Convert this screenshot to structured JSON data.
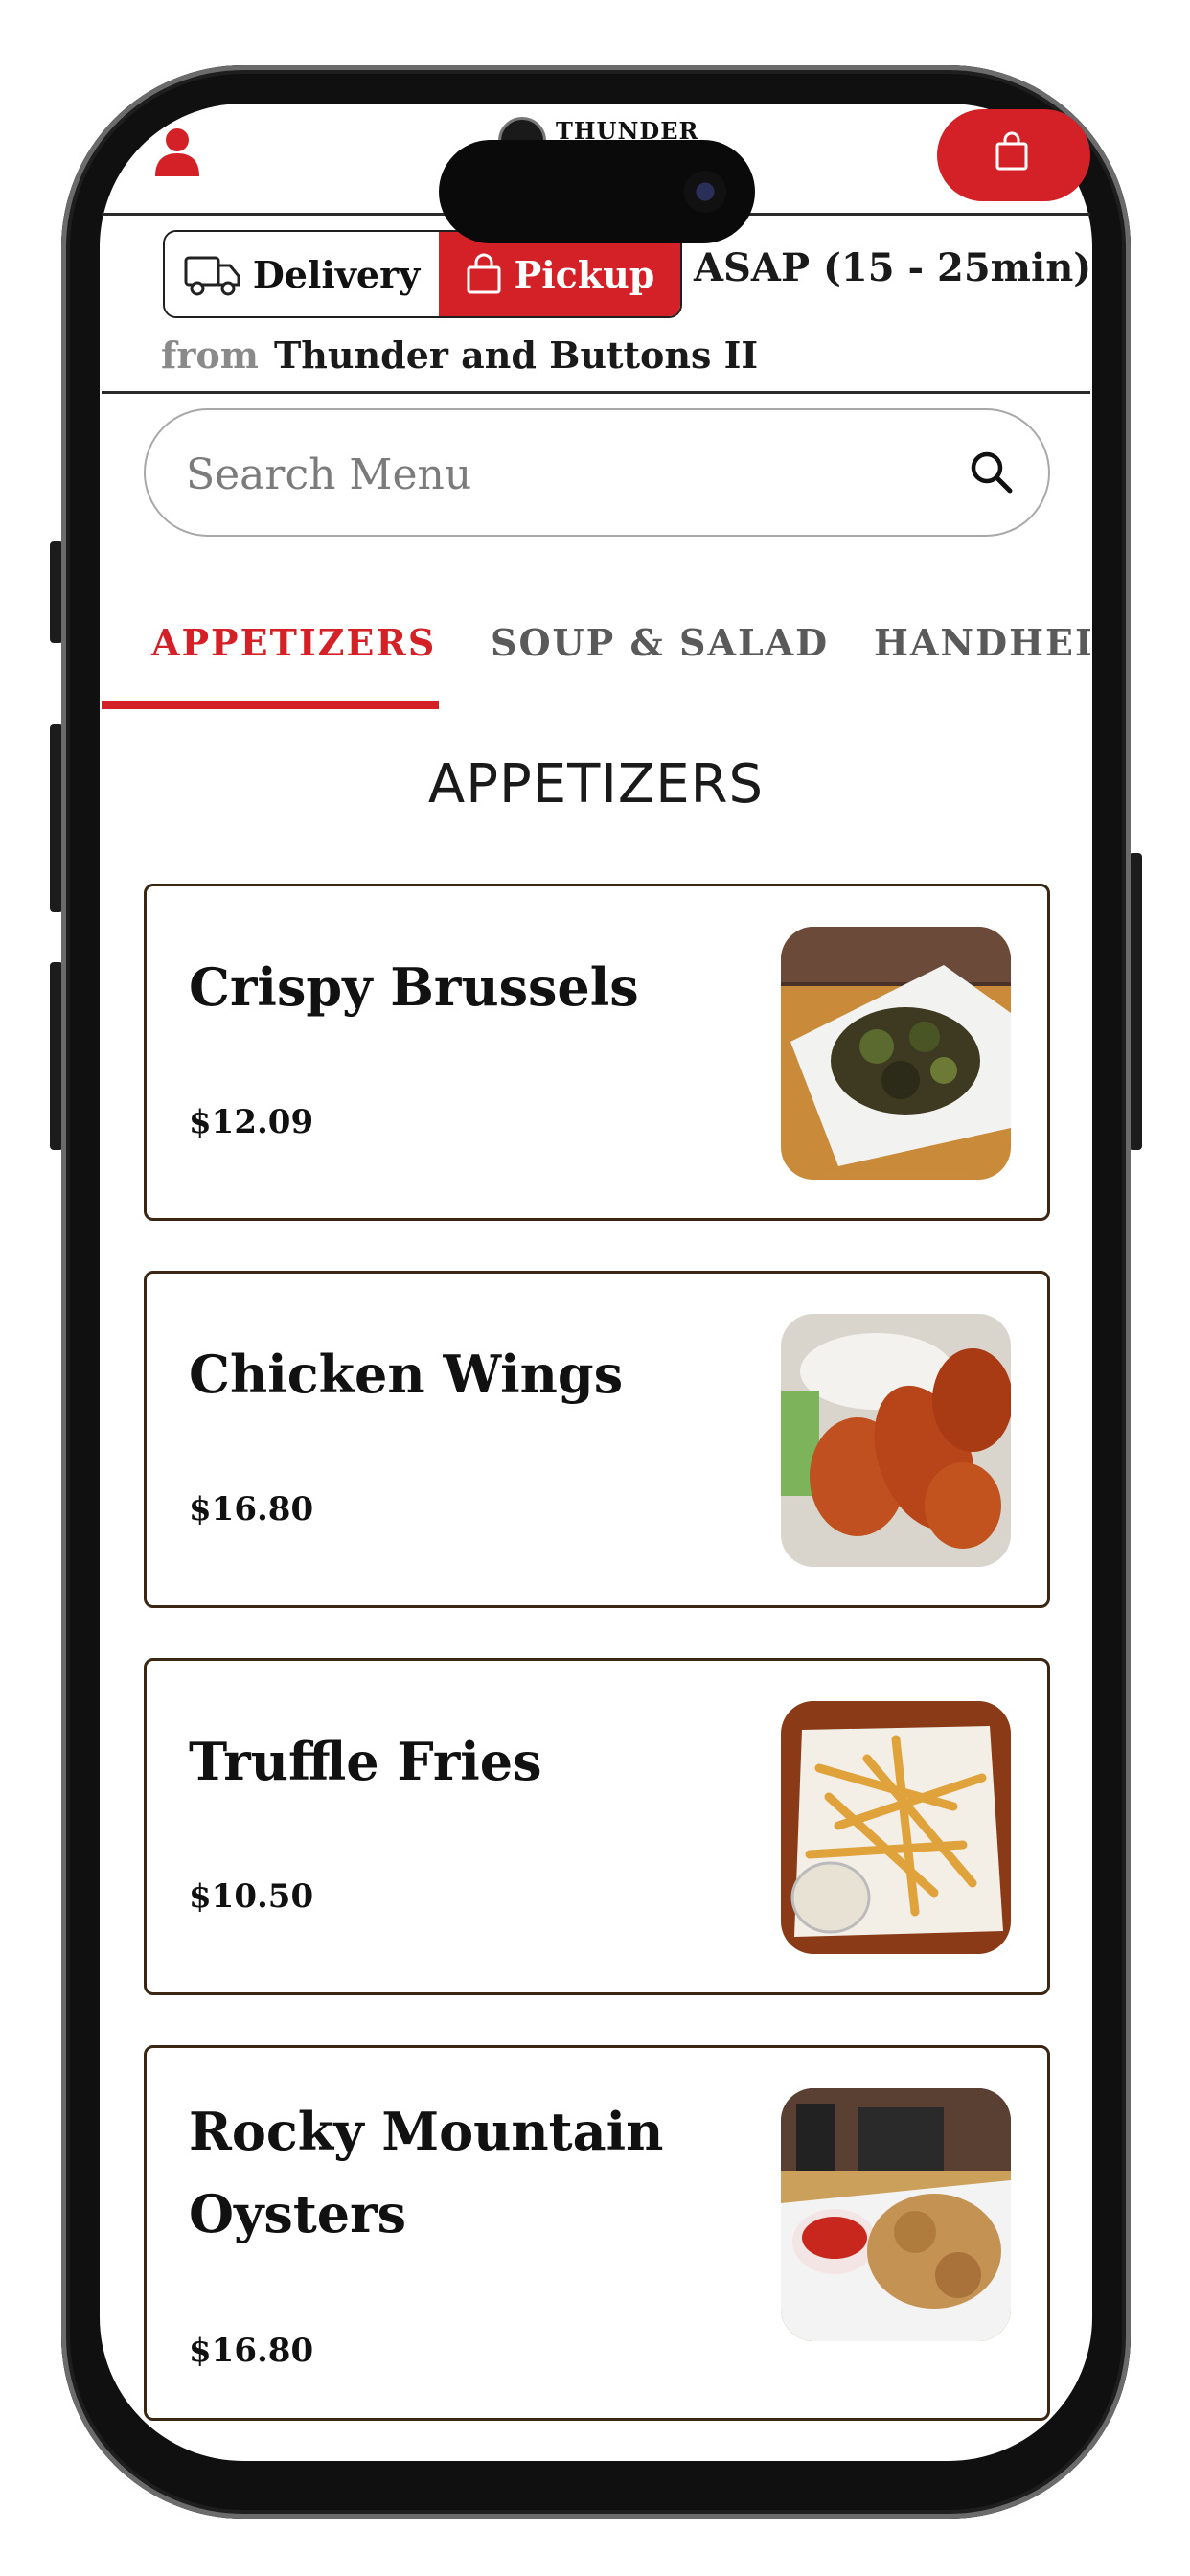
{
  "header": {
    "logo_text": "THUNDER",
    "user_icon": "user-icon",
    "cart_icon": "shopping-bag-icon"
  },
  "order_mode": {
    "delivery_label": "Delivery",
    "pickup_label": "Pickup",
    "selected": "Pickup",
    "eta": "ASAP (15 - 25min)",
    "from_label": "from",
    "location": "Thunder and Buttons II"
  },
  "search": {
    "placeholder": "Search Menu",
    "value": ""
  },
  "tabs": [
    {
      "label": "APPETIZERS",
      "active": true
    },
    {
      "label": "SOUP & SALAD",
      "active": false
    },
    {
      "label": "HANDHELDS",
      "active": false
    }
  ],
  "section_title": "APPETIZERS",
  "items": [
    {
      "name": "Crispy Brussels",
      "price": "$12.09"
    },
    {
      "name": "Chicken Wings",
      "price": "$16.80"
    },
    {
      "name": "Truffle Fries",
      "price": "$10.50"
    },
    {
      "name": "Rocky Mountain Oysters",
      "price": "$16.80"
    }
  ],
  "colors": {
    "accent": "#d42027",
    "card_border": "#3a2612",
    "text": "#111111",
    "muted": "#8a8a8a"
  }
}
